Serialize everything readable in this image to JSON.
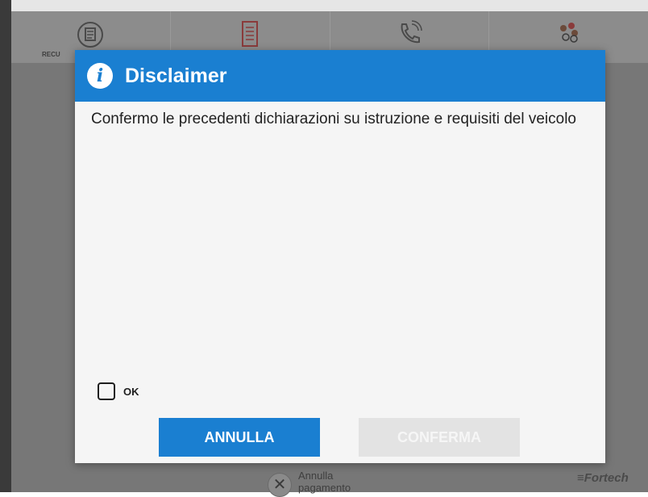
{
  "nav": {
    "items": [
      {
        "icon": "receipt-cycle-icon",
        "label": "RECU"
      },
      {
        "icon": "document-icon",
        "label": ""
      },
      {
        "icon": "phone-icon",
        "label": ""
      },
      {
        "icon": "people-icon",
        "label": ""
      }
    ]
  },
  "dialog": {
    "title": "Disclaimer",
    "message": "Confermo le precedenti dichiarazioni su istruzione e requisiti del veicolo",
    "checkbox_label": "OK",
    "checkbox_checked": false,
    "cancel_label": "ANNULLA",
    "confirm_label": "CONFERMA",
    "confirm_enabled": false
  },
  "footer": {
    "cancel_payment_line1": "Annulla",
    "cancel_payment_line2": "pagamento",
    "brand": "≡Fortech"
  },
  "colors": {
    "accent": "#1a7fd1",
    "dialog_bg": "#f5f5f5",
    "disabled_button": "#e3e3e3"
  }
}
